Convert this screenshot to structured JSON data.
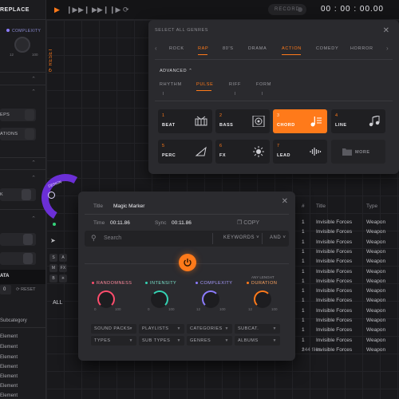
{
  "sidebar": {
    "title": "REPLACE",
    "complexity_label": "COMPLEXITY",
    "complexity_min": "12",
    "complexity_max": "100",
    "reset_label": "RESET",
    "row_texts": [
      "EPS",
      "ATIONS"
    ],
    "row_k": "K",
    "data_label": "ATA",
    "data_value": "0",
    "data_reset": "RESET",
    "subcategory": "Subcategory",
    "elements": [
      "Element",
      "Element",
      "Element",
      "Element",
      "Element",
      "Element",
      "Element"
    ],
    "all_label": "ALL"
  },
  "transport": {
    "record_label": "RECORD",
    "timecode": "00 : 00 : 00.00"
  },
  "genre_modal": {
    "header": "SELECT ALL GENRES",
    "genres": [
      "ROCK",
      "RAP",
      "80'S",
      "DRAMA",
      "ACTION",
      "COMEDY",
      "HORROR"
    ],
    "active_genres": [
      "RAP",
      "ACTION"
    ],
    "advanced_label": "ADVANCED",
    "subgenres": [
      "RHYTHM",
      "PULSE",
      "RIFF",
      "FORM"
    ],
    "active_subgenre": "PULSE",
    "pads": [
      {
        "num": "1",
        "name": "BEAT",
        "icon": "drum-icon"
      },
      {
        "num": "2",
        "name": "BASS",
        "icon": "speaker-icon"
      },
      {
        "num": "3",
        "name": "CHORD",
        "icon": "notes-icon"
      },
      {
        "num": "4",
        "name": "LINE",
        "icon": "music-note-icon"
      },
      {
        "num": "5",
        "name": "PERC",
        "icon": "percussion-icon"
      },
      {
        "num": "6",
        "name": "FX",
        "icon": "burst-icon"
      },
      {
        "num": "7",
        "name": "LEAD",
        "icon": "waveform-icon"
      },
      {
        "num": "",
        "name": "MORE",
        "icon": "folder-icon"
      }
    ],
    "active_pad": "CHORD"
  },
  "sample_panel": {
    "title_label": "Title",
    "title_value": "Magic Marker",
    "time_label": "Time",
    "time_value": "00:11.86",
    "sync_label": "Sync",
    "sync_value": "00:11.86",
    "copy_label": "COPY",
    "search_placeholder": "Search",
    "keywords_label": "KEYWORDS",
    "and_label": "AND",
    "params": [
      {
        "label": "RANDOMNESS",
        "color": "#ff4d6d",
        "min": "0",
        "max": "100"
      },
      {
        "label": "INTENSITY",
        "color": "#34d3b4",
        "min": "0",
        "max": "100"
      },
      {
        "label": "COMPLEXITY",
        "color": "#8c7cff",
        "min": "12",
        "max": "100"
      },
      {
        "label": "DURATION",
        "color": "#ff7a1a",
        "min": "12",
        "max": "100",
        "sub": "ANY LENGHT"
      }
    ],
    "dropdowns": [
      "SOUND PACKS",
      "PLAYLISTS",
      "CATEGORIES",
      "SUBCAT.",
      "TYPES",
      "SUB TYPES",
      "GENRES",
      "ALBUMS"
    ]
  },
  "results_table": {
    "headers": [
      "#",
      "Title",
      "Type"
    ],
    "rows": [
      {
        "num": "1",
        "title": "Invisible Forces",
        "type": "Weapon"
      },
      {
        "num": "1",
        "title": "Invisible Forces",
        "type": "Weapon"
      },
      {
        "num": "1",
        "title": "Invisible Forces",
        "type": "Weapon"
      },
      {
        "num": "1",
        "title": "Invisible Forces",
        "type": "Weapon"
      },
      {
        "num": "1",
        "title": "Invisible Forces",
        "type": "Weapon"
      },
      {
        "num": "1",
        "title": "Invisible Forces",
        "type": "Weapon"
      },
      {
        "num": "1",
        "title": "Invisible Forces",
        "type": "Weapon"
      },
      {
        "num": "1",
        "title": "Invisible Forces",
        "type": "Weapon"
      },
      {
        "num": "1",
        "title": "Invisible Forces",
        "type": "Weapon"
      },
      {
        "num": "1",
        "title": "Invisible Forces",
        "type": "Weapon"
      },
      {
        "num": "1",
        "title": "Invisible Forces",
        "type": "Weapon"
      },
      {
        "num": "1",
        "title": "Invisible Forces",
        "type": "Weapon"
      },
      {
        "num": "1",
        "title": "Invisible Forces",
        "type": "Weapon"
      },
      {
        "num": "1",
        "title": "Invisible Forces",
        "type": "Weapon"
      }
    ],
    "count": "244 files"
  },
  "misc": {
    "keys": [
      "S",
      "A",
      "M",
      "FX",
      "B",
      "✳"
    ],
    "design_label": "DESIGN"
  },
  "colors": {
    "accent": "#ff7a1a",
    "purple": "#6b2fd6"
  }
}
